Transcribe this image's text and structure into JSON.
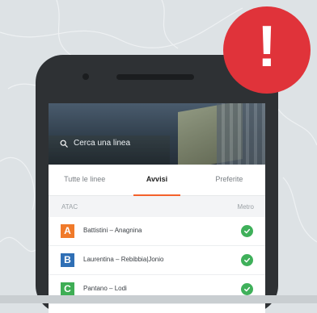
{
  "search": {
    "placeholder": "Cerca una linea",
    "icon": "search-icon"
  },
  "tabs": [
    {
      "label": "Tutte le linee",
      "active": false
    },
    {
      "label": "Avvisi",
      "active": true
    },
    {
      "label": "Preferite",
      "active": false
    }
  ],
  "section": {
    "left": "ATAC",
    "right": "Metro"
  },
  "lines": [
    {
      "badge": "A",
      "name": "Battistini – Anagnina",
      "color": "#f07a2a",
      "status_icon": "check-circle-icon"
    },
    {
      "badge": "B",
      "name": "Laurentina – Rebibbia|Jonio",
      "color": "#2f6fb5",
      "status_icon": "check-circle-icon"
    },
    {
      "badge": "C",
      "name": "Pantano – Lodi",
      "color": "#3fae55",
      "status_icon": "check-circle-icon"
    }
  ],
  "alert": {
    "symbol": "!",
    "color": "#e0333a",
    "icon": "exclamation-icon"
  },
  "colors": {
    "accent": "#f4612b",
    "ok": "#3fb05a"
  }
}
